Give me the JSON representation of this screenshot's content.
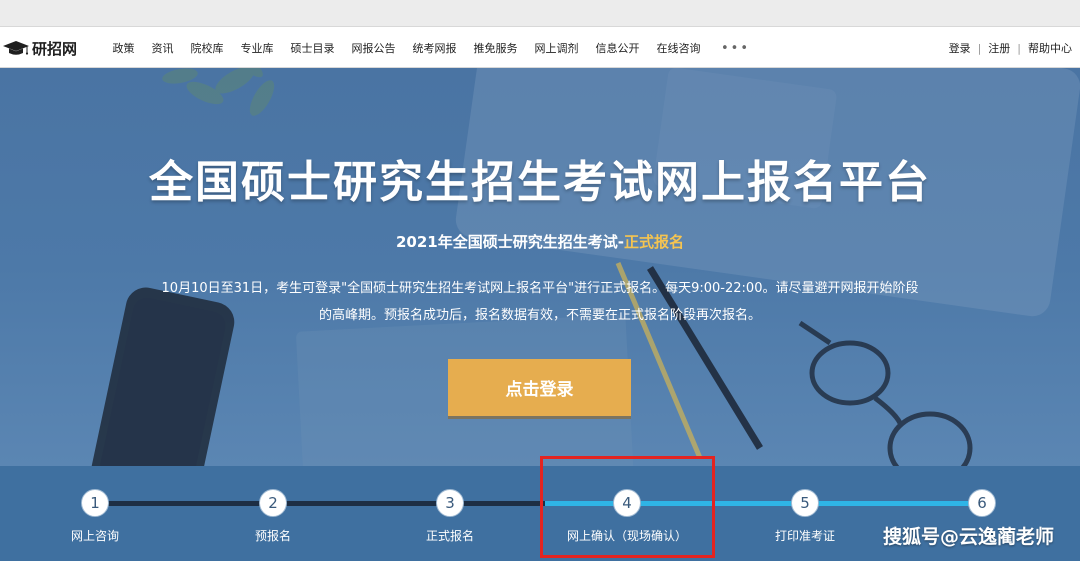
{
  "site": {
    "logo_text": "研招网"
  },
  "nav": {
    "items": [
      "政策",
      "资讯",
      "院校库",
      "专业库",
      "硕士目录",
      "网报公告",
      "统考网报",
      "推免服务",
      "网上调剂",
      "信息公开",
      "在线咨询"
    ],
    "more": "•••",
    "login": "登录",
    "register": "注册",
    "help": "帮助中心",
    "separator": "|"
  },
  "hero": {
    "title": "全国硕士研究生招生考试网上报名平台",
    "subtitle_main": "2021年全国硕士研究生招生考试-",
    "subtitle_highlight": "正式报名",
    "desc_line1": "10月10日至31日，考生可登录\"全国硕士研究生招生考试网上报名平台\"进行正式报名。每天9:00-22:00。请尽量避开网报开始阶段",
    "desc_line2": "的高峰期。预报名成功后，报名数据有效，不需要在正式报名阶段再次报名。",
    "login_button": "点击登录"
  },
  "steps": [
    {
      "num": "1",
      "label": "网上咨询"
    },
    {
      "num": "2",
      "label": "预报名"
    },
    {
      "num": "3",
      "label": "正式报名"
    },
    {
      "num": "4",
      "label": "网上确认（现场确认）"
    },
    {
      "num": "5",
      "label": "打印准考证"
    },
    {
      "num": "6",
      "label": ""
    }
  ],
  "watermark": "搜狐号@云逸蔺老师",
  "colors": {
    "hero_bg": "#4d79a8",
    "accent_button": "#e6ad4f",
    "highlight": "#f5c451",
    "track_done": "#1d2e44",
    "track_pending": "#2fb4e6",
    "annotation_box": "#e42420"
  }
}
